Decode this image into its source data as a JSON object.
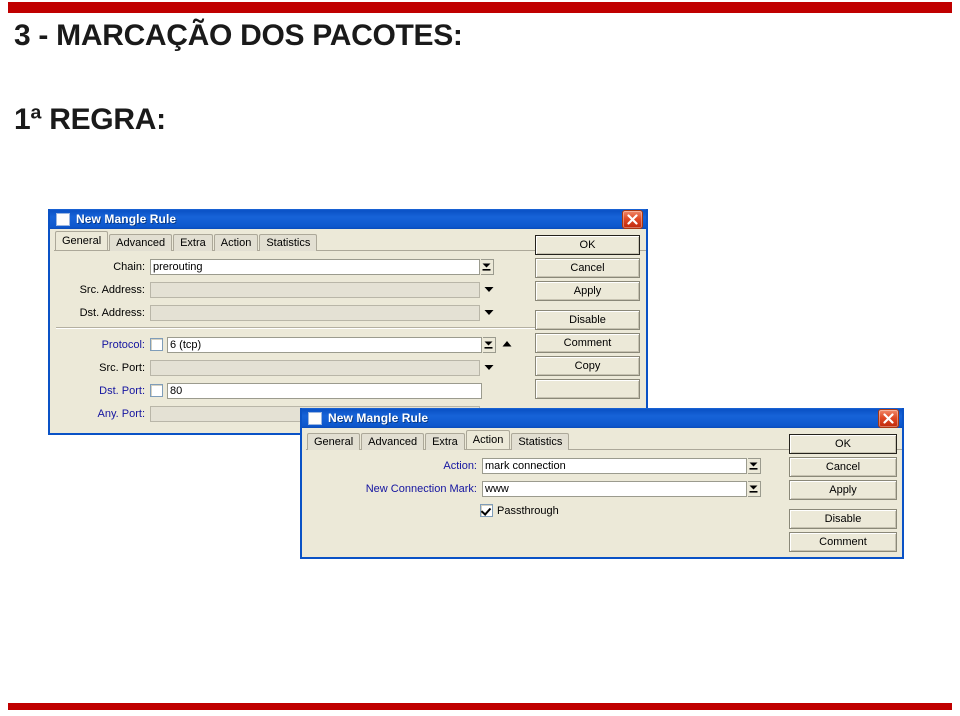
{
  "slide": {
    "title": "3 - MARCAÇÃO DOS PACOTES:",
    "subtitle": "1ª REGRA:",
    "accent_color": "#c00000",
    "background": "#ffffff"
  },
  "windows": [
    {
      "id": "general",
      "title": "New Mangle Rule",
      "sysicon": "window-icon",
      "close_icon": "close-icon",
      "tabs": [
        {
          "label": "General",
          "active": true
        },
        {
          "label": "Advanced",
          "active": false
        },
        {
          "label": "Extra",
          "active": false
        },
        {
          "label": "Action",
          "active": false
        },
        {
          "label": "Statistics",
          "active": false
        }
      ],
      "fields": [
        {
          "label": "Chain:",
          "value": "prerouting",
          "placeholder": "",
          "checkbox": false,
          "checked": false,
          "enabled": true,
          "control": "spinner",
          "label_color": "black"
        },
        {
          "label": "Src. Address:",
          "value": "",
          "placeholder": "",
          "checkbox": false,
          "checked": false,
          "enabled": false,
          "control": "dropdown",
          "label_color": "black"
        },
        {
          "label": "Dst. Address:",
          "value": "",
          "placeholder": "",
          "checkbox": false,
          "checked": false,
          "enabled": false,
          "control": "dropdown",
          "label_color": "black"
        },
        {
          "label": "Protocol:",
          "value": "6 (tcp)",
          "placeholder": "",
          "checkbox": true,
          "checked": false,
          "enabled": true,
          "control": "spinner-up",
          "label_color": "blue"
        },
        {
          "label": "Src. Port:",
          "value": "",
          "placeholder": "",
          "checkbox": false,
          "checked": false,
          "enabled": false,
          "control": "dropdown",
          "label_color": "black"
        },
        {
          "label": "Dst. Port:",
          "value": "80",
          "placeholder": "",
          "checkbox": true,
          "checked": false,
          "enabled": true,
          "control": "none",
          "label_color": "blue"
        },
        {
          "label": "Any. Port:",
          "value": "",
          "placeholder": "",
          "checkbox": false,
          "checked": false,
          "enabled": false,
          "control": "none",
          "label_color": "blue"
        }
      ],
      "buttons": [
        {
          "label": "OK",
          "default": true,
          "gap": false
        },
        {
          "label": "Cancel",
          "default": false,
          "gap": false
        },
        {
          "label": "Apply",
          "default": false,
          "gap": false
        },
        {
          "label": "Disable",
          "default": false,
          "gap": true
        },
        {
          "label": "Comment",
          "default": false,
          "gap": false
        },
        {
          "label": "Copy",
          "default": false,
          "gap": false
        },
        {
          "label": "",
          "default": false,
          "gap": false
        }
      ]
    },
    {
      "id": "action",
      "title": "New Mangle Rule",
      "sysicon": "window-icon",
      "close_icon": "close-icon",
      "tabs": [
        {
          "label": "General",
          "active": false
        },
        {
          "label": "Advanced",
          "active": false
        },
        {
          "label": "Extra",
          "active": false
        },
        {
          "label": "Action",
          "active": true
        },
        {
          "label": "Statistics",
          "active": false
        }
      ],
      "fields": [
        {
          "label": "Action:",
          "value": "mark connection",
          "placeholder": "",
          "checkbox": false,
          "checked": false,
          "enabled": true,
          "control": "spinner",
          "label_color": "blue"
        },
        {
          "label": "New Connection Mark:",
          "value": "www",
          "placeholder": "",
          "checkbox": false,
          "checked": false,
          "enabled": true,
          "control": "spinner",
          "label_color": "blue"
        }
      ],
      "checkbox_row": {
        "label": "Passthrough",
        "checked": true
      },
      "buttons": [
        {
          "label": "OK",
          "default": true,
          "gap": false
        },
        {
          "label": "Cancel",
          "default": false,
          "gap": false
        },
        {
          "label": "Apply",
          "default": false,
          "gap": false
        },
        {
          "label": "Disable",
          "default": false,
          "gap": true
        },
        {
          "label": "Comment",
          "default": false,
          "gap": false
        }
      ]
    }
  ]
}
